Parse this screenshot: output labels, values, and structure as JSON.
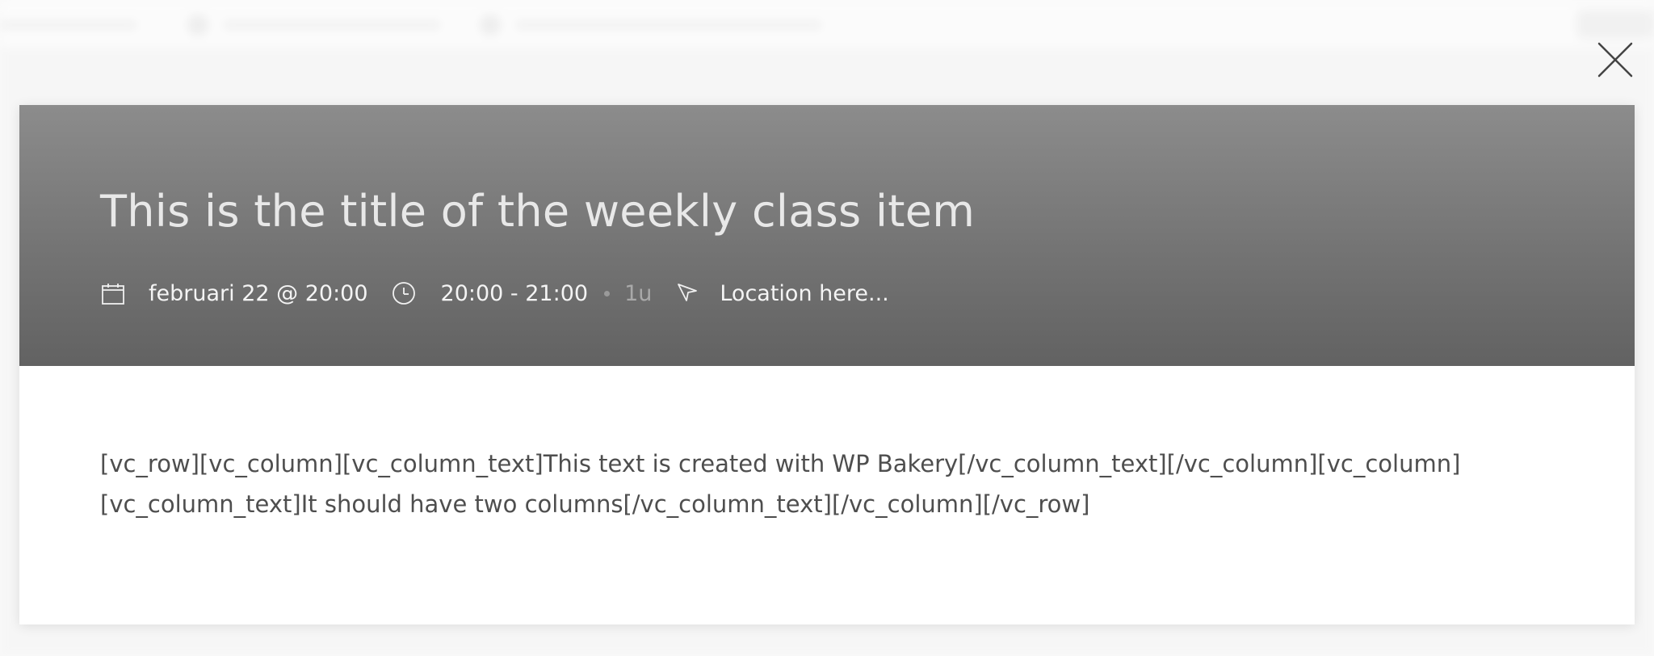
{
  "modal": {
    "title": "This is the title of the weekly class item",
    "meta": {
      "date": "februari 22 @ 20:00",
      "time_range": "20:00 - 21:00",
      "duration": "1u",
      "location": "Location here..."
    },
    "body_lines": [
      "[vc_row][vc_column][vc_column_text]This text is created with WP Bakery[/vc_column_text][/vc_column][vc_column]",
      "[vc_column_text]It should have two columns[/vc_column_text][/vc_column][/vc_row]"
    ]
  },
  "icons": {
    "close": "close-icon",
    "calendar": "calendar-icon",
    "clock": "clock-icon",
    "location": "location-arrow-icon"
  },
  "colors": {
    "header_top": "#8c8c8c",
    "header_bottom": "#626262",
    "title": "#e8e8e8",
    "meta_text": "#f4f4f4",
    "muted": "#a9a9a9",
    "body_text": "#4e4e4e",
    "close_icon": "#444444"
  }
}
